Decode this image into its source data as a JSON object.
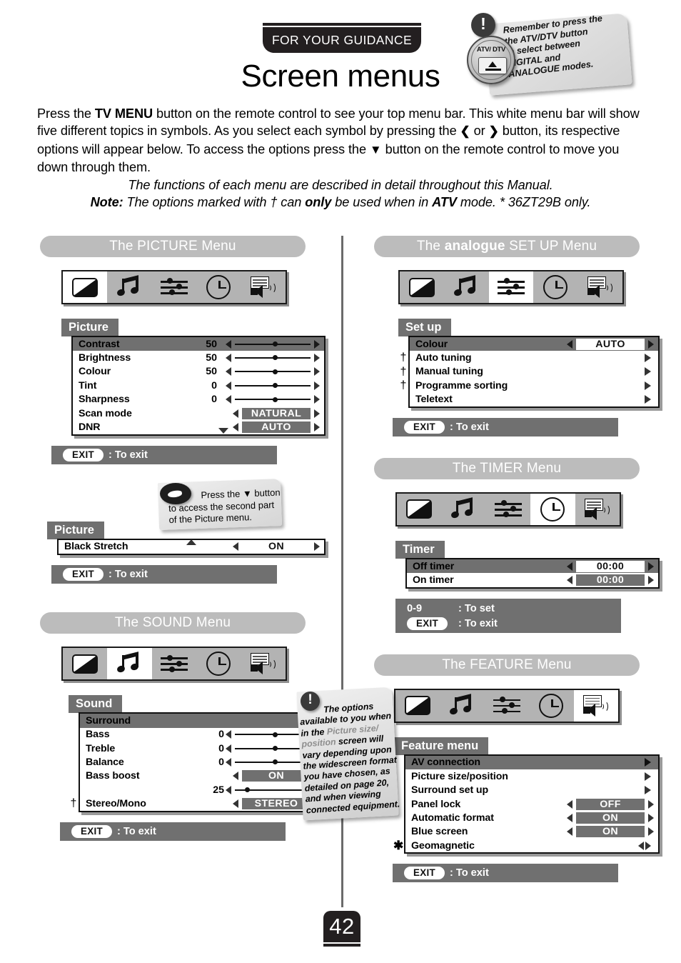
{
  "header": {
    "guidance_label": "FOR YOUR GUIDANCE",
    "title": "Screen menus"
  },
  "atv_callout": {
    "bang": "!",
    "button_label": "ATV/ DTV",
    "line1": "Remember to press the",
    "line2": "the ATV/DTV button",
    "line3": "to select between",
    "line4": "DIGITAL and",
    "line5": "ANALOGUE modes."
  },
  "intro": {
    "p1_a": "Press the ",
    "p1_b": "TV MENU",
    "p1_c": " button on the remote control to see your top menu bar. This white menu bar will show five different topics in symbols. As you select each symbol by pressing the ",
    "p1_d": " or ",
    "p1_e": " button, its respective options will appear below. To access the options press the ",
    "p1_f": " button on the remote control to move you down through them.",
    "left_arrow": "❮",
    "right_arrow": "❯",
    "down_arrow": "▼",
    "p2": "The functions of each menu are described in detail throughout this Manual.",
    "p3_note": "Note:",
    "p3_a": " The options marked with ",
    "p3_dagger": "†",
    "p3_b": " can ",
    "p3_only": "only",
    "p3_c": " be used when in ",
    "p3_atv": "ATV",
    "p3_d": " mode. * 36ZT29B only."
  },
  "icons": {
    "picture": "picture-contrast-icon",
    "music": "music-note-icon",
    "slider": "equalizer-sliders-icon",
    "clock": "clock-icon",
    "av": "screen-speaker-icon"
  },
  "common": {
    "exit_chip": "EXIT",
    "exit_text": ": To exit",
    "set_keys": "0-9",
    "set_text": ": To set",
    "dagger": "†",
    "asterisk": "✱"
  },
  "picture_menu": {
    "section_title": "The PICTURE Menu",
    "active_icon_index": 0,
    "panel_title": "Picture",
    "rows": [
      {
        "label": "Contrast",
        "value": "50",
        "type": "slider",
        "knob": 50,
        "highlight": true
      },
      {
        "label": "Brightness",
        "value": "50",
        "type": "slider",
        "knob": 50,
        "highlight": false
      },
      {
        "label": "Colour",
        "value": "50",
        "type": "slider",
        "knob": 50,
        "highlight": false
      },
      {
        "label": "Tint",
        "value": "0",
        "type": "slider",
        "knob": 50,
        "highlight": false
      },
      {
        "label": "Sharpness",
        "value": "0",
        "type": "slider",
        "knob": 50,
        "highlight": false
      },
      {
        "label": "Scan mode",
        "value": "NATURAL",
        "type": "value-gray",
        "highlight": false
      },
      {
        "label": "DNR",
        "value": "AUTO",
        "type": "value-gray",
        "highlight": false,
        "caret": "down"
      }
    ]
  },
  "picture_note": {
    "line1": "Press the ",
    "down_arrow": "▼",
    "line2": " button",
    "line3": "to access the second part",
    "line4": "of the Picture menu."
  },
  "picture_menu2": {
    "panel_title": "Picture",
    "rows": [
      {
        "label": "Black Stretch",
        "value": "ON",
        "type": "value-white",
        "highlight": false,
        "caret": "up"
      }
    ]
  },
  "sound_menu": {
    "section_title": "The SOUND Menu",
    "active_icon_index": 1,
    "panel_title": "Sound",
    "rows": [
      {
        "label": "Surround",
        "value": "",
        "type": "submenu",
        "highlight": true
      },
      {
        "label": "Bass",
        "value": "0",
        "type": "slider",
        "knob": 50,
        "highlight": false
      },
      {
        "label": "Treble",
        "value": "0",
        "type": "slider",
        "knob": 50,
        "highlight": false
      },
      {
        "label": "Balance",
        "value": "0",
        "type": "slider",
        "knob": 50,
        "highlight": false
      },
      {
        "label": "Bass boost",
        "value": "ON",
        "type": "value-gray",
        "highlight": false
      },
      {
        "label": "",
        "value": "25",
        "type": "slider",
        "knob": 13,
        "highlight": false
      },
      {
        "label": "Stereo/Mono",
        "value": "STEREO",
        "type": "value-gray",
        "highlight": false,
        "dagger": true
      }
    ]
  },
  "sound_note": {
    "l1_a": "The options",
    "l2": "available to you when",
    "l3_a": "in the ",
    "l3_gray": "Picture size/",
    "l4_gray": "position",
    "l4_a": " screen will",
    "l5": "vary depending upon",
    "l6": "the widescreen format",
    "l7": "you have chosen, as",
    "l8": "detailed on page 20,",
    "l9": "and when viewing",
    "l10": "connected equipment."
  },
  "setup_menu": {
    "section_title_a": "The ",
    "section_title_b": "analogue",
    "section_title_c": " SET UP Menu",
    "active_icon_index": 2,
    "panel_title": "Set up",
    "rows": [
      {
        "label": "Colour",
        "value": "AUTO",
        "type": "value-white",
        "highlight": true
      },
      {
        "label": "Auto tuning",
        "value": "",
        "type": "submenu",
        "highlight": false,
        "dagger": true
      },
      {
        "label": "Manual tuning",
        "value": "",
        "type": "submenu",
        "highlight": false,
        "dagger": true
      },
      {
        "label": "Programme sorting",
        "value": "",
        "type": "submenu",
        "highlight": false,
        "dagger": true
      },
      {
        "label": "Teletext",
        "value": "",
        "type": "submenu",
        "highlight": false
      }
    ]
  },
  "timer_menu": {
    "section_title": "The TIMER Menu",
    "active_icon_index": 3,
    "panel_title": "Timer",
    "rows": [
      {
        "label": "Off timer",
        "value": "00:00",
        "type": "value-white",
        "highlight": true
      },
      {
        "label": "On timer",
        "value": "00:00",
        "type": "value-gray",
        "highlight": false
      }
    ]
  },
  "feature_menu": {
    "section_title": "The FEATURE Menu",
    "active_icon_index": 4,
    "panel_title": "Feature menu",
    "rows": [
      {
        "label": "AV connection",
        "value": "",
        "type": "submenu",
        "highlight": true
      },
      {
        "label": "Picture size/position",
        "value": "",
        "type": "submenu",
        "highlight": false
      },
      {
        "label": "Surround set up",
        "value": "",
        "type": "submenu",
        "highlight": false
      },
      {
        "label": "Panel lock",
        "value": "OFF",
        "type": "value-gray",
        "highlight": false
      },
      {
        "label": "Automatic format",
        "value": "ON",
        "type": "value-gray",
        "highlight": false
      },
      {
        "label": "Blue screen",
        "value": "ON",
        "type": "value-gray",
        "highlight": false
      },
      {
        "label": "Geomagnetic",
        "value": "",
        "type": "tinyarrows",
        "highlight": false,
        "asterisk": true
      }
    ]
  },
  "footer": {
    "page_number": "42"
  },
  "colors": {
    "ink": "#231f20",
    "pill_gray": "#bcbcbc",
    "osd_gray": "#707070",
    "iconbar_gray": "#b3b3b3"
  }
}
